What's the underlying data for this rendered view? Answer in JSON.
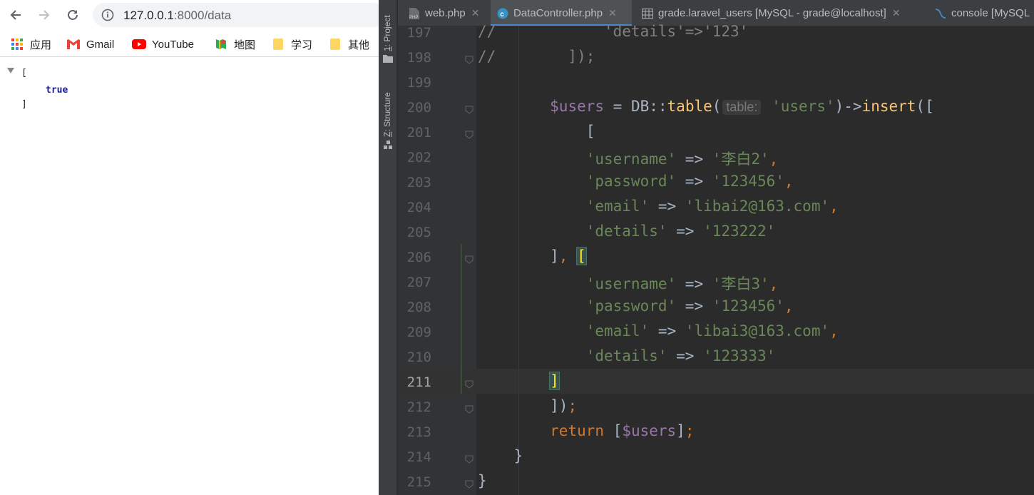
{
  "browser": {
    "nav": {
      "back_icon": "arrow-left-icon",
      "forward_icon": "arrow-right-icon",
      "reload_icon": "reload-icon"
    },
    "omnibox": {
      "host": "127.0.0.1",
      "rest": ":8000/data",
      "info_icon": "info-icon"
    },
    "bookmarks": [
      {
        "label": "应用",
        "icon": "apps-grid-icon"
      },
      {
        "label": "Gmail",
        "icon": "gmail-icon"
      },
      {
        "label": "YouTube",
        "icon": "youtube-icon"
      },
      {
        "label": "地图",
        "icon": "maps-icon"
      },
      {
        "label": "学习",
        "icon": "folder-icon"
      },
      {
        "label": "其他",
        "icon": "folder-icon"
      }
    ],
    "json_view": {
      "open": "[",
      "value": "true",
      "close": "]"
    }
  },
  "ide": {
    "side_tools": [
      {
        "num": "1",
        "label": "Project"
      },
      {
        "num": "Z",
        "label": "Structure"
      }
    ],
    "tabs": [
      {
        "label": "web.php",
        "icon": "php-file-icon",
        "active": false
      },
      {
        "label": "DataController.php",
        "icon": "php-class-icon",
        "active": true
      },
      {
        "label": "grade.laravel_users [MySQL - grade@localhost]",
        "icon": "table-icon",
        "active": false
      },
      {
        "label": "console [MySQL",
        "icon": "console-icon",
        "active": false
      }
    ],
    "current_line": "211",
    "inlay_hint": "table:",
    "lines": [
      {
        "n": "197",
        "text": "//            'details'=>'123'"
      },
      {
        "n": "198",
        "text": "//        ]);"
      },
      {
        "n": "199",
        "text": ""
      },
      {
        "n": "200",
        "text": "        $users = DB::table( 'users')->insert(["
      },
      {
        "n": "201",
        "text": "            ["
      },
      {
        "n": "202",
        "text": "            'username' => '李白2',"
      },
      {
        "n": "203",
        "text": "            'password' => '123456',"
      },
      {
        "n": "204",
        "text": "            'email' => 'libai2@163.com',"
      },
      {
        "n": "205",
        "text": "            'details' => '123222'"
      },
      {
        "n": "206",
        "text": "        ], ["
      },
      {
        "n": "207",
        "text": "            'username' => '李白3',"
      },
      {
        "n": "208",
        "text": "            'password' => '123456',"
      },
      {
        "n": "209",
        "text": "            'email' => 'libai3@163.com',"
      },
      {
        "n": "210",
        "text": "            'details' => '123333'"
      },
      {
        "n": "211",
        "text": "        ]"
      },
      {
        "n": "212",
        "text": "        ]);"
      },
      {
        "n": "213",
        "text": "        return [$users];"
      },
      {
        "n": "214",
        "text": "    }"
      },
      {
        "n": "215",
        "text": "}"
      }
    ],
    "colors": {
      "editor_bg": "#2b2b2b",
      "gutter_bg": "#313335",
      "comment": "#808080",
      "string": "#6a8759",
      "variable": "#9876aa",
      "keyword": "#cc7832",
      "function": "#ffc66d",
      "bracket_match": "#ffef28",
      "active_tab_underline": "#4a88c7"
    }
  }
}
